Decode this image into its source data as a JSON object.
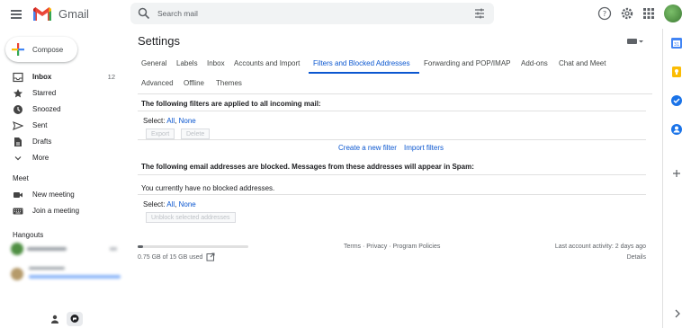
{
  "header": {
    "brand": "Gmail",
    "search_placeholder": "Search mail"
  },
  "nav": {
    "compose": "Compose",
    "items": [
      {
        "label": "Inbox",
        "count": "12",
        "icon": "inbox-icon"
      },
      {
        "label": "Starred",
        "count": "",
        "icon": "star-icon"
      },
      {
        "label": "Snoozed",
        "count": "",
        "icon": "clock-icon"
      },
      {
        "label": "Sent",
        "count": "",
        "icon": "send-icon"
      },
      {
        "label": "Drafts",
        "count": "",
        "icon": "draft-icon"
      },
      {
        "label": "More",
        "count": "",
        "icon": "chevron-down-icon"
      }
    ],
    "meet_title": "Meet",
    "meet_items": [
      {
        "label": "New meeting",
        "icon": "video-icon"
      },
      {
        "label": "Join a meeting",
        "icon": "keyboard-icon"
      }
    ],
    "hangouts_title": "Hangouts"
  },
  "settings": {
    "title": "Settings",
    "tabs": [
      {
        "label": "General"
      },
      {
        "label": "Labels"
      },
      {
        "label": "Inbox"
      },
      {
        "label": "Accounts and Import"
      },
      {
        "label": "Filters and Blocked Addresses"
      },
      {
        "label": "Forwarding and POP/IMAP"
      },
      {
        "label": "Add-ons"
      },
      {
        "label": "Chat and Meet"
      },
      {
        "label": "Advanced"
      },
      {
        "label": "Offline"
      },
      {
        "label": "Themes"
      }
    ],
    "active_tab": "Filters and Blocked Addresses",
    "filters_heading": "The following filters are applied to all incoming mail:",
    "select_label": "Select:",
    "select_all": "All",
    "select_none": "None",
    "export_button": "Export",
    "delete_button": "Delete",
    "create_filter_link": "Create a new filter",
    "import_filters_link": "Import filters",
    "blocked_heading": "The following email addresses are blocked. Messages from these addresses will appear in Spam:",
    "no_blocked": "You currently have no blocked addresses.",
    "unblock_button": "Unblock selected addresses"
  },
  "footer": {
    "storage": "0.75 GB of 15 GB used",
    "storage_fraction": 0.05,
    "links": "Terms · Privacy · Program Policies",
    "last_activity": "Last account activity: 2 days ago",
    "details": "Details"
  },
  "colors": {
    "accent": "#0b57d0",
    "muted": "#5f6368"
  }
}
